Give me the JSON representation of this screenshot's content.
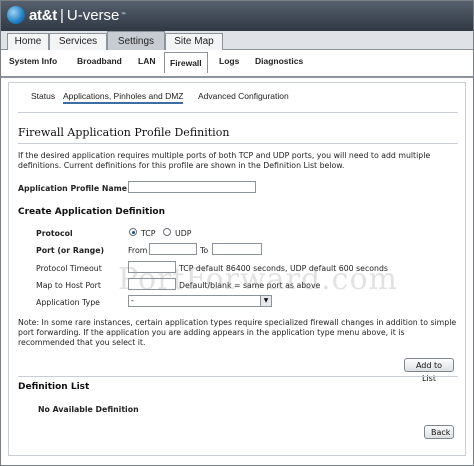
{
  "brand": {
    "name": "at&t",
    "separator": "|",
    "product": "U-verse",
    "tm": "™"
  },
  "top_tabs": [
    {
      "label": "Home"
    },
    {
      "label": "Services"
    },
    {
      "label": "Settings"
    },
    {
      "label": "Site Map"
    }
  ],
  "sub_tabs": [
    {
      "label": "System Info"
    },
    {
      "label": "Broadband"
    },
    {
      "label": "LAN"
    },
    {
      "label": "Firewall"
    },
    {
      "label": "Logs"
    },
    {
      "label": "Diagnostics"
    }
  ],
  "section_nav": [
    {
      "label": "Status"
    },
    {
      "label": "Applications, Pinholes and DMZ"
    },
    {
      "label": "Advanced Configuration"
    }
  ],
  "page_title": "Firewall Application Profile Definition",
  "intro_text": "If the desired application requires multiple ports of both TCP and UDP ports, you will need to add multiple definitions. Current definitions for this profile are shown in the Definition List below.",
  "profile_name": {
    "label": "Application Profile Name",
    "value": ""
  },
  "create_heading": "Create Application Definition",
  "protocol": {
    "label": "Protocol",
    "option_tcp": "TCP",
    "option_udp": "UDP",
    "selected": "TCP"
  },
  "port_range": {
    "label": "Port (or Range)",
    "from_label": "From",
    "to_label": "To",
    "from_value": "",
    "to_value": ""
  },
  "protocol_timeout": {
    "label": "Protocol Timeout",
    "value": "",
    "hint": "TCP default 86400 seconds, UDP default 600 seconds"
  },
  "map_to_host_port": {
    "label": "Map to Host Port",
    "value": "",
    "hint": "Default/blank = same port as above"
  },
  "application_type": {
    "label": "Application Type",
    "selected": "-"
  },
  "note_text": "Note: In some rare instances, certain application types require specialized firewall changes in addition to simple port forwarding. If the application you are adding appears in the application type menu above, it is recommended that you select it.",
  "add_button": "Add to List",
  "definition_list": {
    "heading": "Definition List",
    "empty_text": "No Available Definition"
  },
  "back_button": "Back",
  "watermark": "PortForward.com",
  "colors": {
    "header_bg": "#3f4954",
    "tab_bg": "#dfe3e8",
    "active_underline": "#3a6ea5"
  }
}
